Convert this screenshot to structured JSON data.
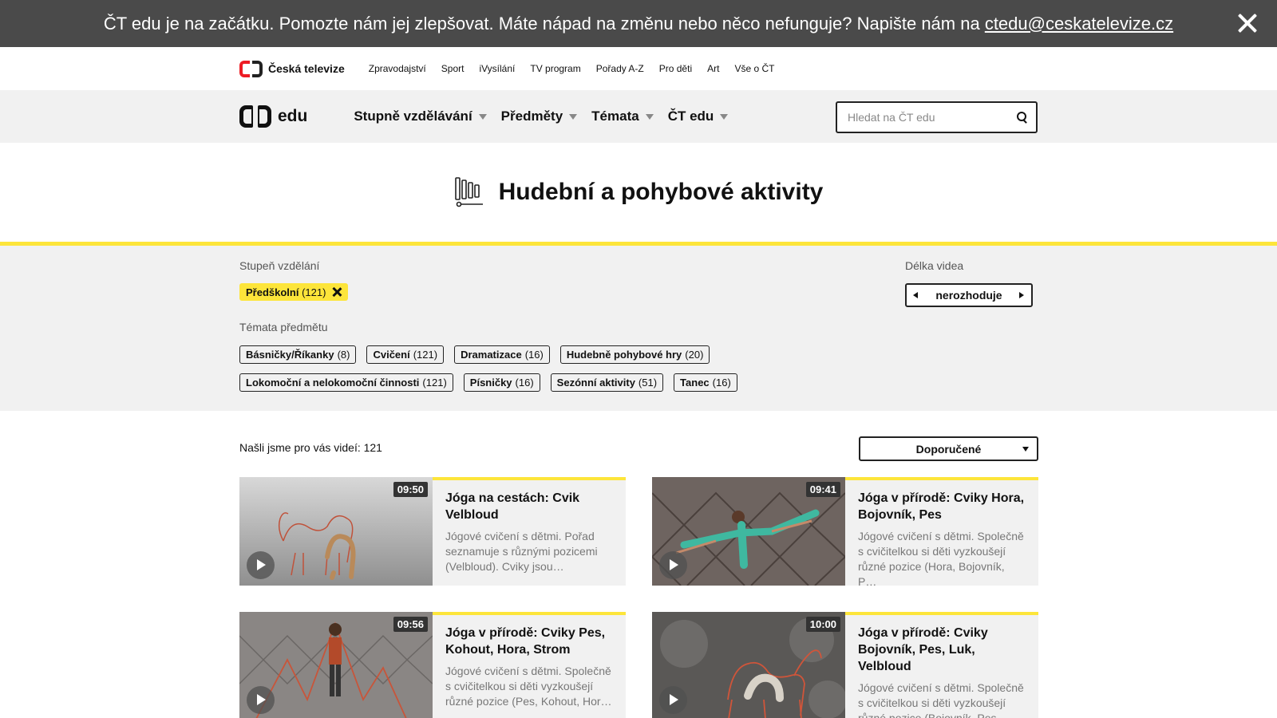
{
  "notice": {
    "text": "ČT edu je na začátku. Pomozte nám jej zlepšovat. Máte nápad na změnu nebo něco nefunguje? Napište nám na ",
    "email": "ctedu@ceskatelevize.cz"
  },
  "ct": {
    "brand": "Česká televize",
    "nav": [
      "Zpravodajství",
      "Sport",
      "iVysílání",
      "TV program",
      "Pořady A-Z",
      "Pro děti",
      "Art",
      "Vše o ČT"
    ]
  },
  "edu": {
    "brand": "edu",
    "nav": [
      "Stupně vzdělávání",
      "Předměty",
      "Témata",
      "ČT edu"
    ],
    "search_placeholder": "Hledat na ČT edu"
  },
  "page": {
    "title": "Hudební a pohybové aktivity"
  },
  "filters": {
    "stupen_label": "Stupeň vzdělání",
    "stupen_active": {
      "label": "Předškolní",
      "count": "(121)"
    },
    "temata_label": "Témata předmětu",
    "tags_row1": [
      {
        "label": "Básničky/Říkanky",
        "count": "(8)"
      },
      {
        "label": "Cvičení",
        "count": "(121)"
      },
      {
        "label": "Dramatizace",
        "count": "(16)"
      },
      {
        "label": "Hudebně pohybové hry",
        "count": "(20)"
      }
    ],
    "tags_row2": [
      {
        "label": "Lokomoční a nelokomoční činnosti",
        "count": "(121)"
      },
      {
        "label": "Písničky",
        "count": "(16)"
      },
      {
        "label": "Sezónní aktivity",
        "count": "(51)"
      },
      {
        "label": "Tanec",
        "count": "(16)"
      }
    ],
    "delka_label": "Délka videa",
    "delka_value": "nerozhoduje"
  },
  "results": {
    "count_text": "Našli jsme pro vás videí: 121",
    "sort_value": "Doporučené",
    "videos": [
      {
        "title": "Jóga na cestách: Cvik Velbloud",
        "duration": "09:50",
        "desc": "Jógové cvičení s dětmi. Pořad seznamuje s různými pozicemi (Velbloud). Cviky jsou…"
      },
      {
        "title": "Jóga v přírodě: Cviky Hora, Bojovník, Pes",
        "duration": "09:41",
        "desc": "Jógové cvičení s dětmi. Společně s cvičitelkou si děti vyzkoušejí různé pozice (Hora, Bojovník, P…"
      },
      {
        "title": "Jóga v přírodě: Cviky Pes, Kohout, Hora, Strom",
        "duration": "09:56",
        "desc": "Jógové cvičení s dětmi. Společně s cvičitelkou si děti vyzkoušejí různé pozice (Pes, Kohout, Hor…"
      },
      {
        "title": "Jóga v přírodě: Cviky Bojovník, Pes, Luk, Velbloud",
        "duration": "10:00",
        "desc": "Jógové cvičení s dětmi. Společně s cvičitelkou si děti vyzkoušejí různé pozice (Bojovník, Pes tvá…"
      }
    ]
  },
  "colors": {
    "accent": "#fde53a",
    "notice_bg": "#4a4a4a",
    "panel_bg": "#f1f1f1"
  }
}
